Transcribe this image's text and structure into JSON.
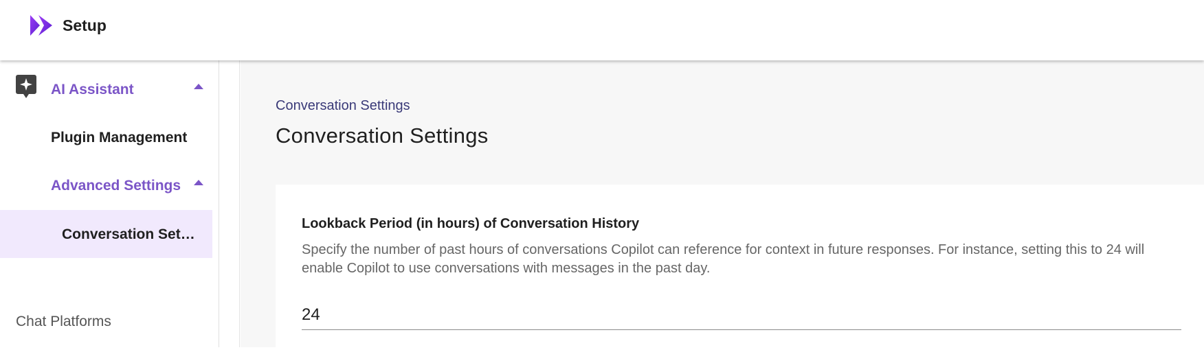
{
  "app": {
    "title": "Setup",
    "logo_icon": "double-chevron-logo-icon",
    "brand_color": "#7b2ff7"
  },
  "sidebar": {
    "items": [
      {
        "label": "AI Assistant",
        "icon": "sparkle-chat-icon",
        "expanded": true,
        "color": "#7b55c7"
      },
      {
        "label": "Plugin Management"
      },
      {
        "label": "Advanced Settings",
        "expanded": true,
        "color": "#7b55c7"
      },
      {
        "label": "Conversation Set…",
        "active": true
      }
    ],
    "section_label": "Chat Platforms"
  },
  "main": {
    "breadcrumb": "Conversation Settings",
    "title": "Conversation Settings",
    "field": {
      "label": "Lookback Period (in hours) of Conversation History",
      "help": "Specify the number of past hours of conversations Copilot can reference for context in future responses. For instance, setting this to 24 will enable Copilot to use conversations with messages in the past day.",
      "value": "24"
    }
  }
}
